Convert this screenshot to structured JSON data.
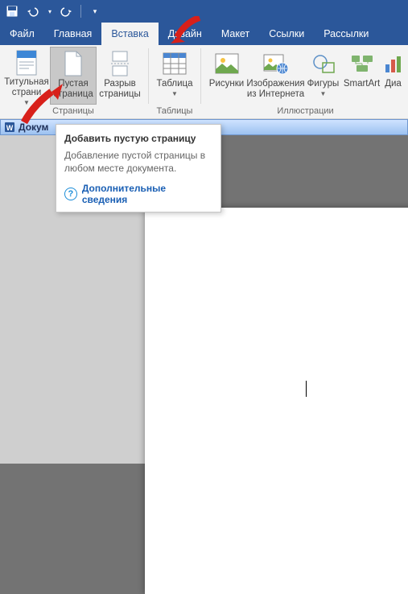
{
  "qat": {
    "save": "save-icon",
    "undo": "undo-icon",
    "redo": "redo-icon",
    "customize": "customize-icon"
  },
  "tabs": {
    "file": "Файл",
    "home": "Главная",
    "insert": "Вставка",
    "design": "Дизайн",
    "layout": "Макет",
    "references": "Ссылки",
    "mailings": "Рассылки"
  },
  "ribbon": {
    "pages": {
      "cover": "Титульная страни",
      "blank": "Пустая страница",
      "break": "Разрыв страницы",
      "label": "Страницы"
    },
    "tables": {
      "table": "Таблица",
      "label": "Таблицы"
    },
    "illustrations": {
      "pictures": "Рисунки",
      "online": "Изображения из Интернета",
      "shapes": "Фигуры",
      "smartart": "SmartArt",
      "chart": "Диа",
      "label": "Иллюстрации"
    }
  },
  "titlebar": {
    "text": "Докум"
  },
  "tooltip": {
    "title": "Добавить пустую страницу",
    "body": "Добавление пустой страницы в любом месте документа.",
    "link": "Дополнительные сведения"
  }
}
